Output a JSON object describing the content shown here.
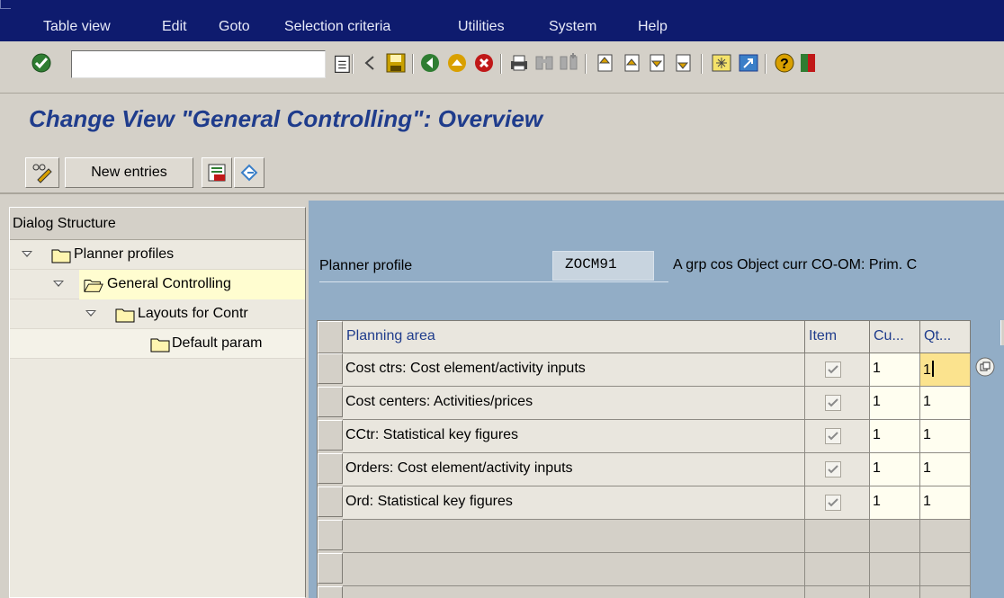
{
  "menu": [
    "Table view",
    "Edit",
    "Goto",
    "Selection criteria",
    "Utilities",
    "System",
    "Help"
  ],
  "title": "Change View \"General Controlling\": Overview",
  "app_toolbar": {
    "new_entries": "New entries"
  },
  "dialog_structure": {
    "header": "Dialog Structure",
    "items": [
      {
        "label": "Planner profiles",
        "level": 0
      },
      {
        "label": "General Controlling",
        "level": 1,
        "selected": true
      },
      {
        "label": "Layouts for Contr",
        "level": 2
      },
      {
        "label": "Default param",
        "level": 3
      }
    ]
  },
  "planner_profile": {
    "label": "Planner profile",
    "value": "ZOCM91",
    "description": "A grp cos Object curr CO-OM: Prim. C"
  },
  "table": {
    "columns": [
      "Planning area",
      "Item",
      "Cu...",
      "Qt..."
    ],
    "rows": [
      {
        "area": "Cost ctrs: Cost element/activity inputs",
        "item": true,
        "cu": "1",
        "qt": "1"
      },
      {
        "area": "Cost centers: Activities/prices",
        "item": true,
        "cu": "1",
        "qt": "1"
      },
      {
        "area": "CCtr: Statistical key figures",
        "item": true,
        "cu": "1",
        "qt": "1"
      },
      {
        "area": "Orders: Cost element/activity inputs",
        "item": true,
        "cu": "1",
        "qt": "1"
      },
      {
        "area": "Ord: Statistical key figures",
        "item": true,
        "cu": "1",
        "qt": "1"
      }
    ]
  },
  "colors": {
    "menubar": "#0e1b6e",
    "work_area": "#92adc6",
    "title": "#1f3c8c",
    "selected": "#fffdd0",
    "focus_cell": "#fbe38e"
  }
}
